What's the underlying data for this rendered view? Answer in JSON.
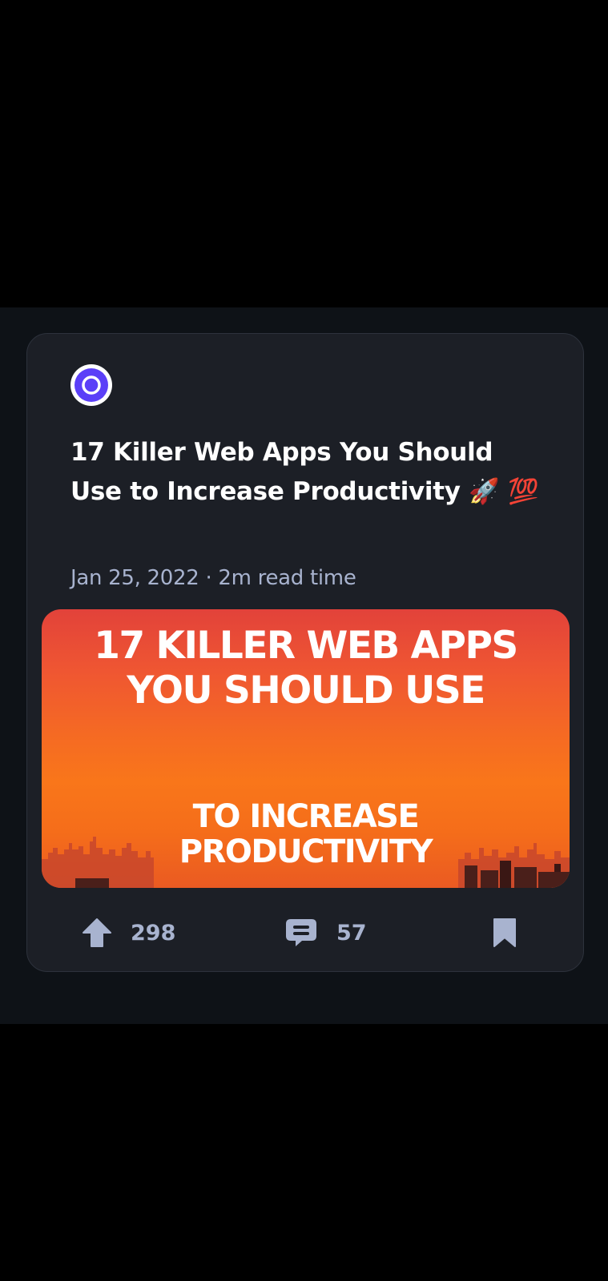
{
  "post": {
    "title": "17 Killer Web Apps You Should Use to Increase Productivity 🚀 💯",
    "meta": "Jan 25, 2022 · 2m read time",
    "cover": {
      "line1": "17 KILLER WEB APPS",
      "line2": "YOU SHOULD USE",
      "line3": "TO INCREASE",
      "line4": "PRODUCTIVITY"
    },
    "upvotes": "298",
    "comments": "57"
  },
  "icons": {
    "source": "source-logo-icon",
    "upvote": "upvote-arrow-icon",
    "comment": "comment-icon",
    "bookmark": "bookmark-icon"
  },
  "colors": {
    "card_background": "#1c1f26",
    "accent": "#5b3ff8",
    "action_gray": "#a8b3cf"
  }
}
